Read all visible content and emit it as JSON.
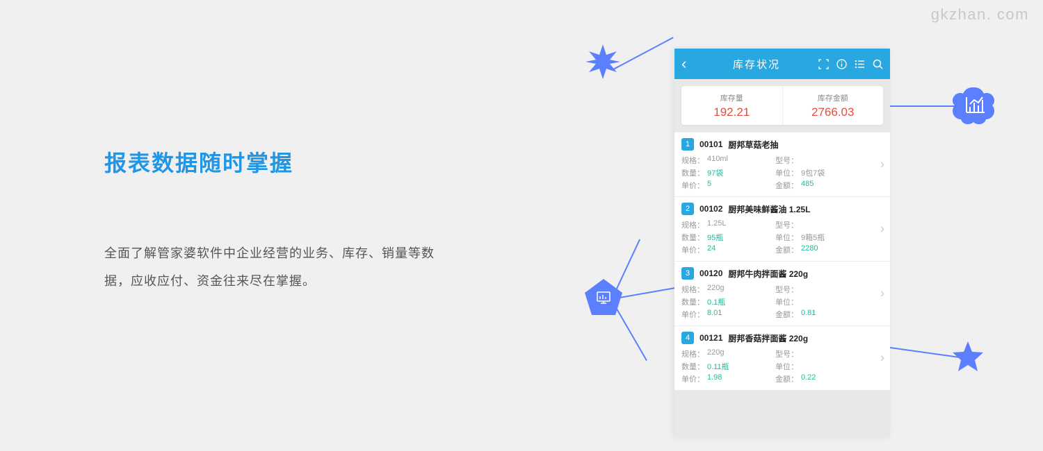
{
  "watermark": "gkzhan. com",
  "left": {
    "heading": "报表数据随时掌握",
    "description": "全面了解管家婆软件中企业经营的业务、库存、销量等数据，应收应付、资金往来尽在掌握。"
  },
  "phone": {
    "header_title": "库存状况",
    "back": "‹",
    "summary": [
      {
        "label": "库存量",
        "value": "192.21"
      },
      {
        "label": "库存金额",
        "value": "2766.03"
      }
    ],
    "labels": {
      "spec": "规格：",
      "model": "型号：",
      "qty": "数量：",
      "unit": "单位：",
      "price": "单价：",
      "amount": "金额："
    },
    "items": [
      {
        "badge": "1",
        "code": "00101",
        "name": "厨邦草菇老抽",
        "spec": "410ml",
        "model": "",
        "qty": "97袋",
        "unit": "9包7袋",
        "price": "5",
        "amount": "485"
      },
      {
        "badge": "2",
        "code": "00102",
        "name": "厨邦美味鲜酱油 1.25L",
        "spec": "1.25L",
        "model": "",
        "qty": "95瓶",
        "unit": "9箱5瓶",
        "price": "24",
        "amount": "2280"
      },
      {
        "badge": "3",
        "code": "00120",
        "name": "厨邦牛肉拌面酱 220g",
        "spec": "220g",
        "model": "",
        "qty": "0.1瓶",
        "unit": "",
        "price": "8.01",
        "amount": "0.81"
      },
      {
        "badge": "4",
        "code": "00121",
        "name": "厨邦香菇拌面酱 220g",
        "spec": "220g",
        "model": "",
        "qty": "0.11瓶",
        "unit": "",
        "price": "1.98",
        "amount": "0.22"
      }
    ]
  },
  "icons": {
    "scan": "scan-icon",
    "info": "info-icon",
    "list": "list-icon",
    "search": "search-icon"
  },
  "colors": {
    "primary": "#29a7e1",
    "accent": "#5b7fff",
    "danger": "#e74c3c",
    "teal": "#1abc9c"
  }
}
